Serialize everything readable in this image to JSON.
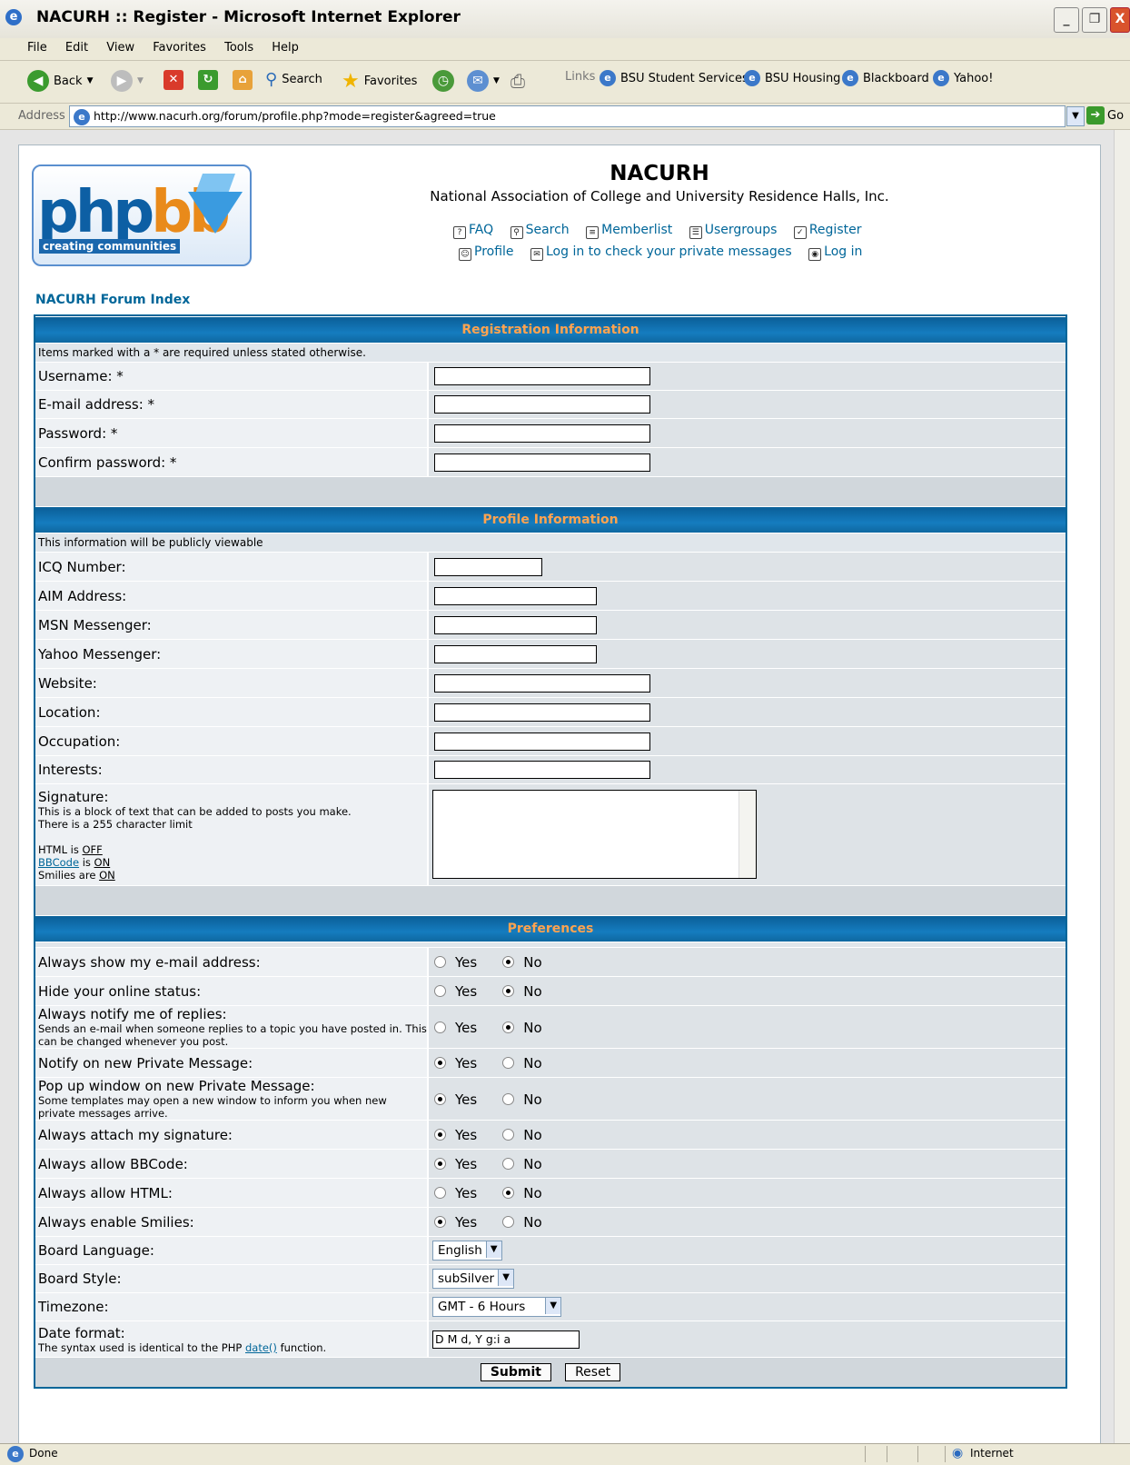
{
  "window": {
    "title": "NACURH :: Register - Microsoft Internet Explorer",
    "controls": [
      "_",
      "❐",
      "X"
    ]
  },
  "menu": [
    "File",
    "Edit",
    "View",
    "Favorites",
    "Tools",
    "Help"
  ],
  "toolbar": {
    "back": "Back",
    "search": "Search",
    "favorites": "Favorites",
    "links_label": "Links",
    "links": [
      "BSU Student Services",
      "BSU Housing",
      "Blackboard",
      "Yahoo!"
    ]
  },
  "address": {
    "label": "Address",
    "url": "http://www.nacurh.org/forum/profile.php?mode=register&agreed=true",
    "go": "Go"
  },
  "site": {
    "title": "NACURH",
    "description": "National Association of College and University Residence Halls, Inc.",
    "logo_text_a": "php",
    "logo_text_b": "bb",
    "logo_tagline": "creating communities",
    "nav": [
      "FAQ",
      "Search",
      "Memberlist",
      "Usergroups",
      "Register"
    ],
    "nav2": [
      "Profile",
      "Log in to check your private messages",
      "Log in"
    ],
    "index_link": "NACURH Forum Index"
  },
  "registration": {
    "header": "Registration Information",
    "note": "Items marked with a * are required unless stated otherwise.",
    "fields": [
      "Username: *",
      "E-mail address: *",
      "Password: *",
      "Confirm password: *"
    ]
  },
  "profile": {
    "header": "Profile Information",
    "note": "This information will be publicly viewable",
    "fields": [
      "ICQ Number:",
      "AIM Address:",
      "MSN Messenger:",
      "Yahoo Messenger:",
      "Website:",
      "Location:",
      "Occupation:",
      "Interests:"
    ],
    "signature_label": "Signature:",
    "signature_desc1": "This is a block of text that can be added to posts you make.",
    "signature_desc2": "There is a 255 character limit",
    "html_label": "HTML is",
    "html_state": "OFF",
    "bbcode_label": "BBCode",
    "bbcode_is": "is",
    "bbcode_state": "ON",
    "smilies_label": "Smilies are",
    "smilies_state": "ON"
  },
  "preferences": {
    "header": "Preferences",
    "yes": "Yes",
    "no": "No",
    "items": [
      {
        "label": "Always show my e-mail address:",
        "desc": "",
        "value": "No"
      },
      {
        "label": "Hide your online status:",
        "desc": "",
        "value": "No"
      },
      {
        "label": "Always notify me of replies:",
        "desc": "Sends an e-mail when someone replies to a topic you have posted in. This can be changed whenever you post.",
        "value": "No"
      },
      {
        "label": "Notify on new Private Message:",
        "desc": "",
        "value": "Yes"
      },
      {
        "label": "Pop up window on new Private Message:",
        "desc": "Some templates may open a new window to inform you when new private messages arrive.",
        "value": "Yes"
      },
      {
        "label": "Always attach my signature:",
        "desc": "",
        "value": "Yes"
      },
      {
        "label": "Always allow BBCode:",
        "desc": "",
        "value": "Yes"
      },
      {
        "label": "Always allow HTML:",
        "desc": "",
        "value": "No"
      },
      {
        "label": "Always enable Smilies:",
        "desc": "",
        "value": "Yes"
      }
    ],
    "language_label": "Board Language:",
    "language_value": "English",
    "style_label": "Board Style:",
    "style_value": "subSilver",
    "timezone_label": "Timezone:",
    "timezone_value": "GMT - 6 Hours",
    "dateformat_label": "Date format:",
    "dateformat_desc_a": "The syntax used is identical to the PHP",
    "dateformat_desc_link": "date()",
    "dateformat_desc_b": "function.",
    "dateformat_value": "D M d, Y g:i a"
  },
  "buttons": {
    "submit": "Submit",
    "reset": "Reset"
  },
  "status": {
    "left": "Done",
    "zone": "Internet"
  }
}
